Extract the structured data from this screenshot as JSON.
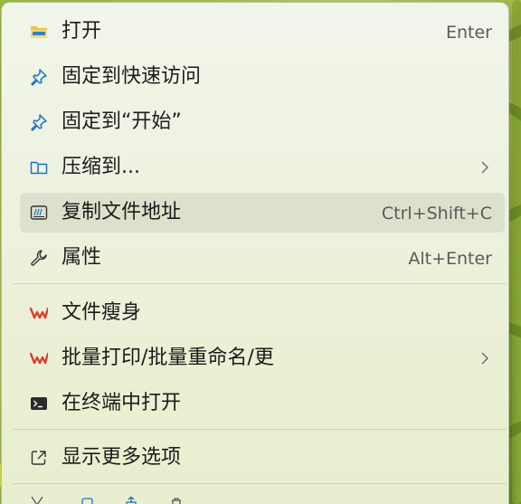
{
  "menu": {
    "items": [
      {
        "label": "打开",
        "shortcut": "Enter",
        "icon": "folder-icon"
      },
      {
        "label": "固定到快速访问",
        "icon": "pin-icon"
      },
      {
        "label": "固定到“开始”",
        "icon": "pin-icon"
      },
      {
        "label": "压缩到...",
        "icon": "zip-folder-icon"
      },
      {
        "label": "复制文件地址",
        "shortcut": "Ctrl+Shift+C",
        "icon": "copy-path-icon"
      },
      {
        "label": "属性",
        "shortcut": "Alt+Enter",
        "icon": "wrench-icon"
      },
      {
        "label": "文件瘦身",
        "icon": "wps-icon"
      },
      {
        "label": "批量打印/批量重命名/更",
        "icon": "wps-icon"
      },
      {
        "label": "在终端中打开",
        "icon": "terminal-icon"
      },
      {
        "label": "显示更多选项",
        "icon": "open-external-icon"
      }
    ]
  },
  "colors": {
    "accent_blue": "#1a73c9",
    "folder_yellow": "#f3c13a",
    "wps_red": "#e23b2f"
  }
}
